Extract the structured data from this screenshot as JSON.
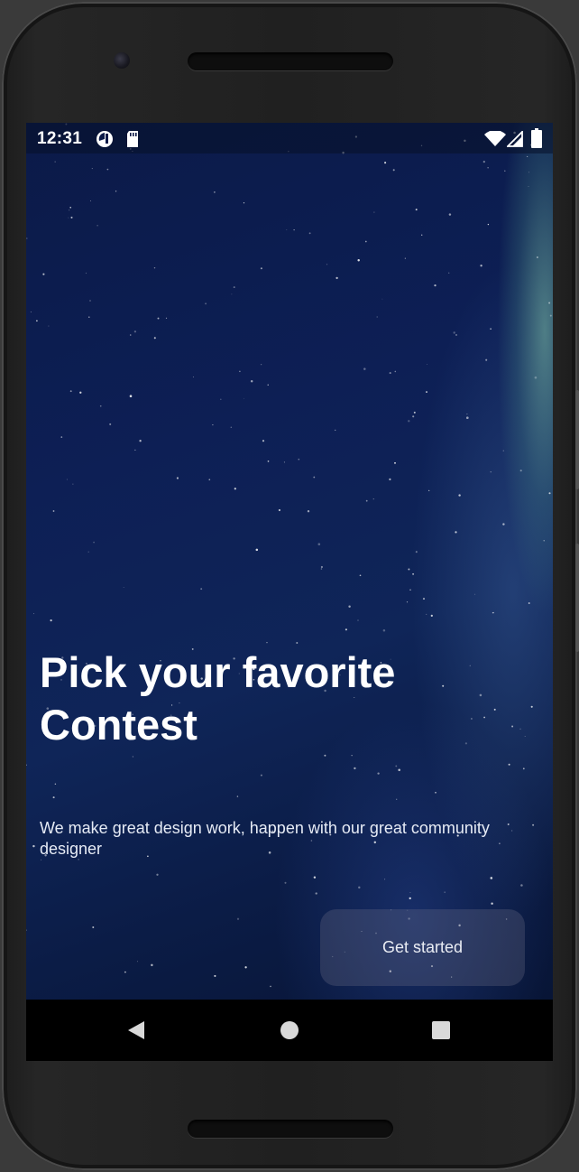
{
  "status_bar": {
    "time": "12:31",
    "left_icons": [
      "pie-chart-icon",
      "sd-card-icon"
    ],
    "right_icons": [
      "wifi-icon",
      "signal-icon",
      "battery-icon"
    ]
  },
  "onboarding": {
    "title": "Pick your favorite Contest",
    "subtitle": "We make great design work, happen with our great community designer",
    "cta_label": "Get started"
  },
  "navigation_bar": {
    "buttons": [
      "back-icon",
      "home-icon",
      "recents-icon"
    ]
  },
  "colors": {
    "background_top": "#0b1a48",
    "background_bottom": "#081536",
    "aurora_accent": "#82c8aa",
    "text_primary": "#ffffff",
    "button_fill": "rgba(120,120,140,0.28)",
    "nav_bar": "#000000"
  }
}
